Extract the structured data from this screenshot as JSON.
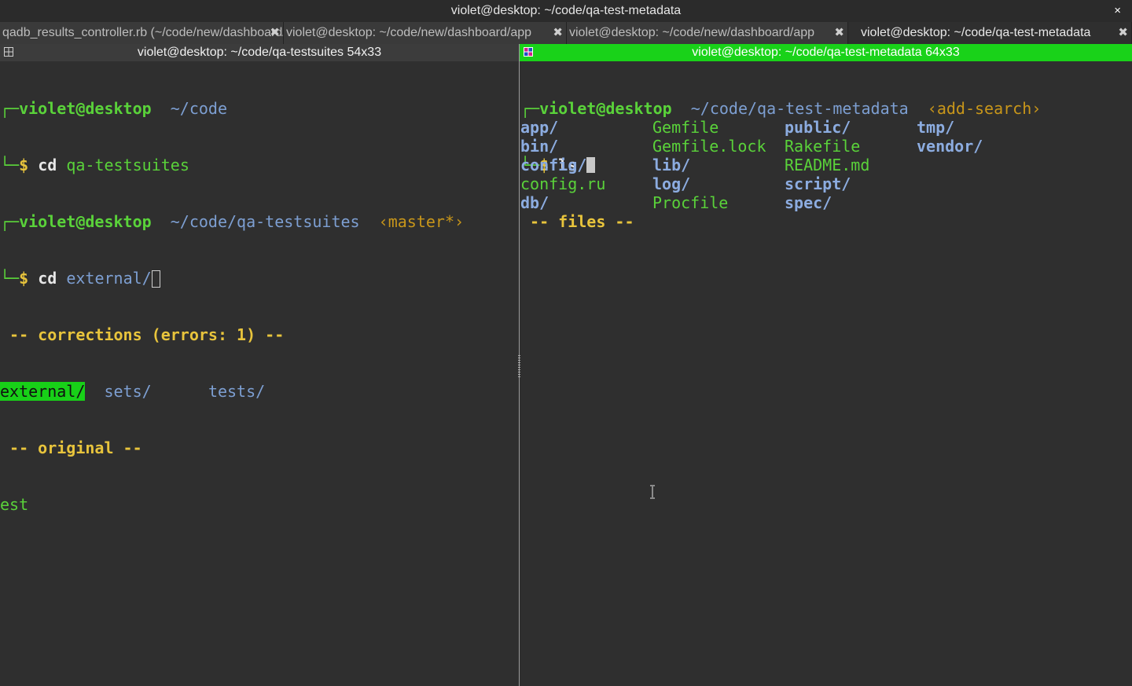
{
  "window": {
    "title": "violet@desktop: ~/code/qa-test-metadata",
    "close_glyph": "×"
  },
  "tabs": [
    {
      "label": "qadb_results_controller.rb (~/code/new/dashboard/app"
    },
    {
      "label": "violet@desktop: ~/code/new/dashboard/app"
    },
    {
      "label": "violet@desktop: ~/code/new/dashboard/app"
    },
    {
      "label": "violet@desktop: ~/code/qa-test-metadata"
    }
  ],
  "tab_close_glyph": "✖",
  "left_pane": {
    "title": "violet@desktop: ~/code/qa-testsuites 54x33",
    "prompt1": {
      "corner": "┌─",
      "user": "violet@desktop",
      "path": "~/code",
      "cont": "└─",
      "dollar": "$",
      "cmd": "cd",
      "arg": "qa-testsuites"
    },
    "prompt2": {
      "corner": "┌─",
      "user": "violet@desktop",
      "path": "~/code/qa-testsuites",
      "branch": "‹master*›",
      "cont": "└─",
      "dollar": "$",
      "cmd": "cd",
      "arg": "external/"
    },
    "corrections_header": " -- corrections (errors: 1) --",
    "corrections": [
      "external/",
      "sets/",
      "tests/"
    ],
    "original_header": " -- original --",
    "original": "est"
  },
  "right_pane": {
    "title": "violet@desktop: ~/code/qa-test-metadata 64x33",
    "prompt": {
      "corner": "┌─",
      "user": "violet@desktop",
      "path": "~/code/qa-test-metadata",
      "branch": "‹add-search›",
      "cont": "└─",
      "dollar": "$",
      "cmd": "ls"
    },
    "files_header": " -- files --",
    "files": [
      [
        "app/",
        "Gemfile",
        "public/",
        "tmp/"
      ],
      [
        "bin/",
        "Gemfile.lock",
        "Rakefile",
        "vendor/"
      ],
      [
        "config/",
        "lib/",
        "README.md",
        ""
      ],
      [
        "config.ru",
        "log/",
        "script/",
        ""
      ],
      [
        "db/",
        "Procfile",
        "spec/",
        ""
      ]
    ]
  },
  "colors": {
    "active_pane_title": "#19d219",
    "prompt_green": "#5ad23a",
    "path_blue": "#7d9fd2",
    "header_yellow": "#e8c43c",
    "branch_orange": "#c8961a"
  }
}
